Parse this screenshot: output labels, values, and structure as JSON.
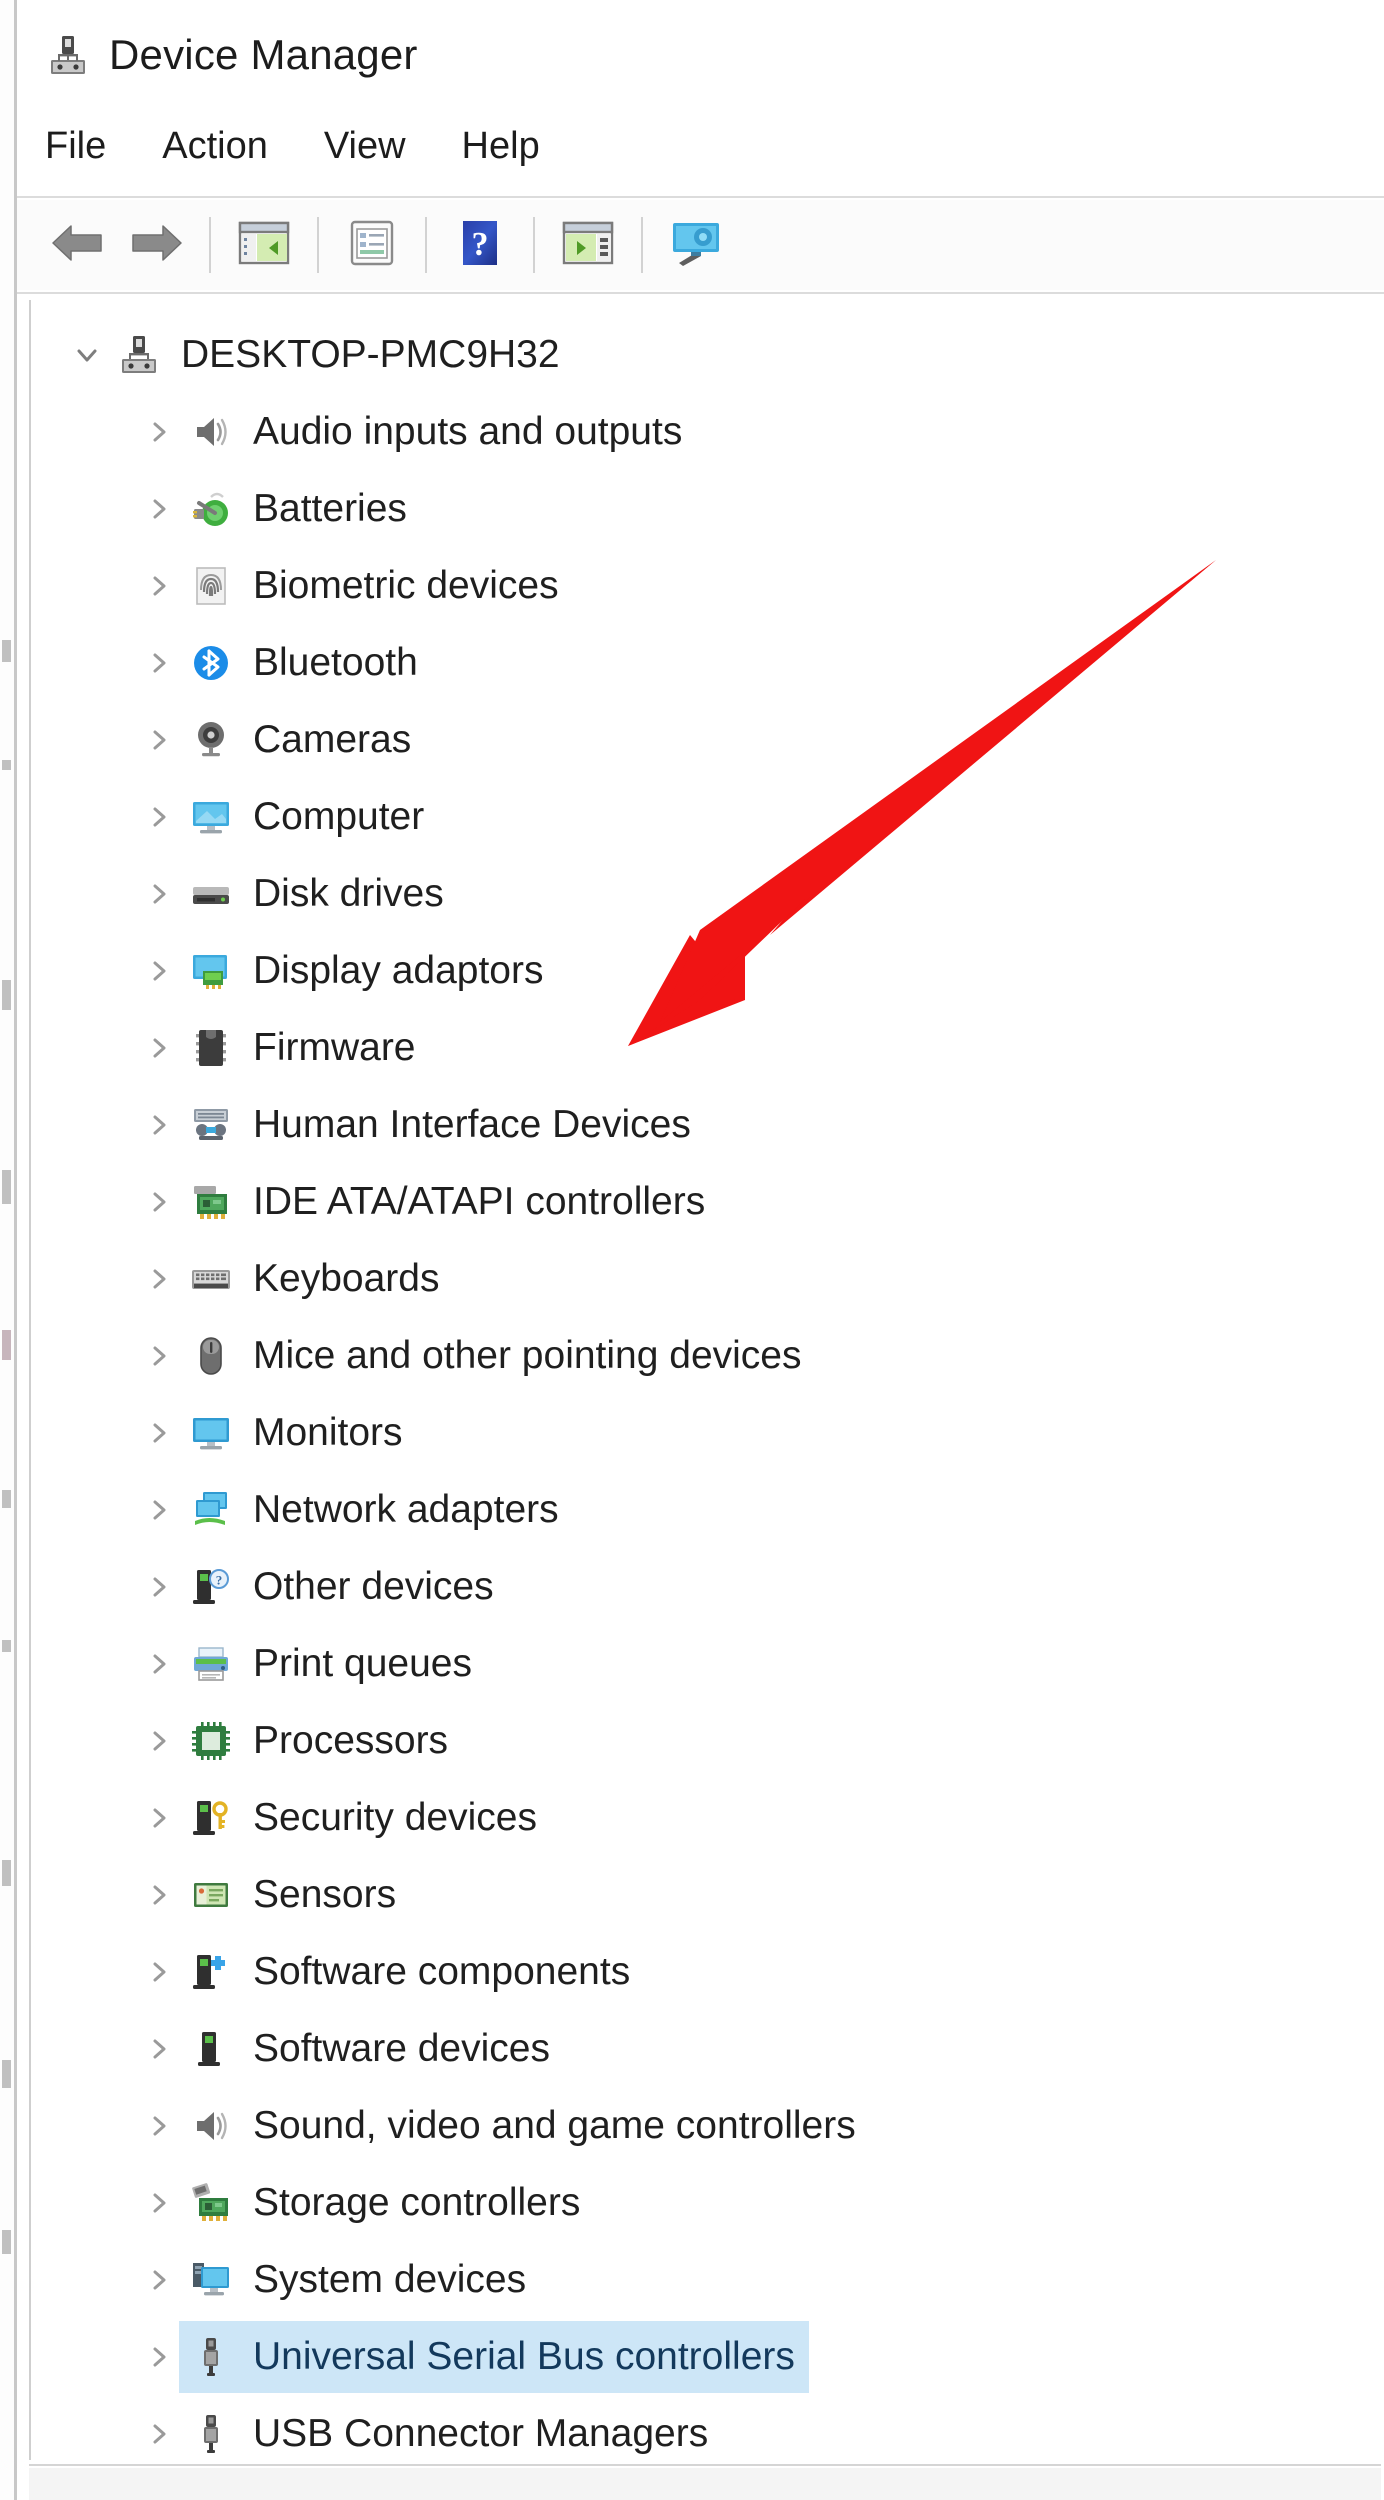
{
  "window": {
    "title": "Device Manager",
    "title_icon": "device-manager-icon"
  },
  "menu": {
    "items": [
      {
        "label": "File",
        "name": "menu-file"
      },
      {
        "label": "Action",
        "name": "menu-action"
      },
      {
        "label": "View",
        "name": "menu-view"
      },
      {
        "label": "Help",
        "name": "menu-help"
      }
    ]
  },
  "toolbar": {
    "buttons": [
      {
        "icon": "back-arrow-icon",
        "label": "Back"
      },
      {
        "icon": "forward-arrow-icon",
        "label": "Forward"
      },
      {
        "icon": "show-hide-console-tree-icon",
        "label": "Show/Hide Console Tree"
      },
      {
        "icon": "properties-icon",
        "label": "Properties"
      },
      {
        "icon": "help-icon",
        "label": "Help"
      },
      {
        "icon": "scan-for-hardware-changes-icon",
        "label": "Scan for hardware changes"
      },
      {
        "icon": "update-driver-icon",
        "label": "Update driver"
      }
    ]
  },
  "tree": {
    "root": {
      "label": "DESKTOP-PMC9H32",
      "icon": "computer-node-icon",
      "expanded": true,
      "chevron": "chevron-down-icon"
    },
    "items": [
      {
        "label": "Audio inputs and outputs",
        "icon": "speaker-icon",
        "selected": false
      },
      {
        "label": "Batteries",
        "icon": "battery-icon",
        "selected": false
      },
      {
        "label": "Biometric devices",
        "icon": "fingerprint-icon",
        "selected": false
      },
      {
        "label": "Bluetooth",
        "icon": "bluetooth-icon",
        "selected": false
      },
      {
        "label": "Cameras",
        "icon": "camera-icon",
        "selected": false
      },
      {
        "label": "Computer",
        "icon": "monitor-icon",
        "selected": false
      },
      {
        "label": "Disk drives",
        "icon": "disk-drive-icon",
        "selected": false
      },
      {
        "label": "Display adaptors",
        "icon": "display-adapter-icon",
        "selected": false
      },
      {
        "label": "Firmware",
        "icon": "chip-icon",
        "selected": false
      },
      {
        "label": "Human Interface Devices",
        "icon": "hid-icon",
        "selected": false
      },
      {
        "label": "IDE ATA/ATAPI controllers",
        "icon": "ide-controller-icon",
        "selected": false
      },
      {
        "label": "Keyboards",
        "icon": "keyboard-icon",
        "selected": false
      },
      {
        "label": "Mice and other pointing devices",
        "icon": "mouse-icon",
        "selected": false
      },
      {
        "label": "Monitors",
        "icon": "monitor-icon",
        "selected": false
      },
      {
        "label": "Network adapters",
        "icon": "network-adapter-icon",
        "selected": false
      },
      {
        "label": "Other devices",
        "icon": "other-device-icon",
        "selected": false
      },
      {
        "label": "Print queues",
        "icon": "printer-icon",
        "selected": false
      },
      {
        "label": "Processors",
        "icon": "processor-icon",
        "selected": false
      },
      {
        "label": "Security devices",
        "icon": "security-device-icon",
        "selected": false
      },
      {
        "label": "Sensors",
        "icon": "sensor-icon",
        "selected": false
      },
      {
        "label": "Software components",
        "icon": "software-component-icon",
        "selected": false
      },
      {
        "label": "Software devices",
        "icon": "software-device-icon",
        "selected": false
      },
      {
        "label": "Sound, video and game controllers",
        "icon": "speaker-icon",
        "selected": false
      },
      {
        "label": "Storage controllers",
        "icon": "storage-controller-icon",
        "selected": false
      },
      {
        "label": "System devices",
        "icon": "system-device-icon",
        "selected": false
      },
      {
        "label": "Universal Serial Bus controllers",
        "icon": "usb-icon",
        "selected": true
      },
      {
        "label": "USB Connector Managers",
        "icon": "usb-icon",
        "selected": false
      }
    ],
    "collapsed_chevron": "chevron-right-icon"
  },
  "annotation": {
    "arrow": {
      "name": "red-pointer-arrow",
      "color": "#f01414",
      "points_to": "Display adaptors"
    }
  },
  "colors": {
    "selection": "#cde6f7",
    "selection_text": "#13395c",
    "text": "#1f1f1f",
    "chevron": "#8a8a8a",
    "annotation_red": "#f01414"
  }
}
